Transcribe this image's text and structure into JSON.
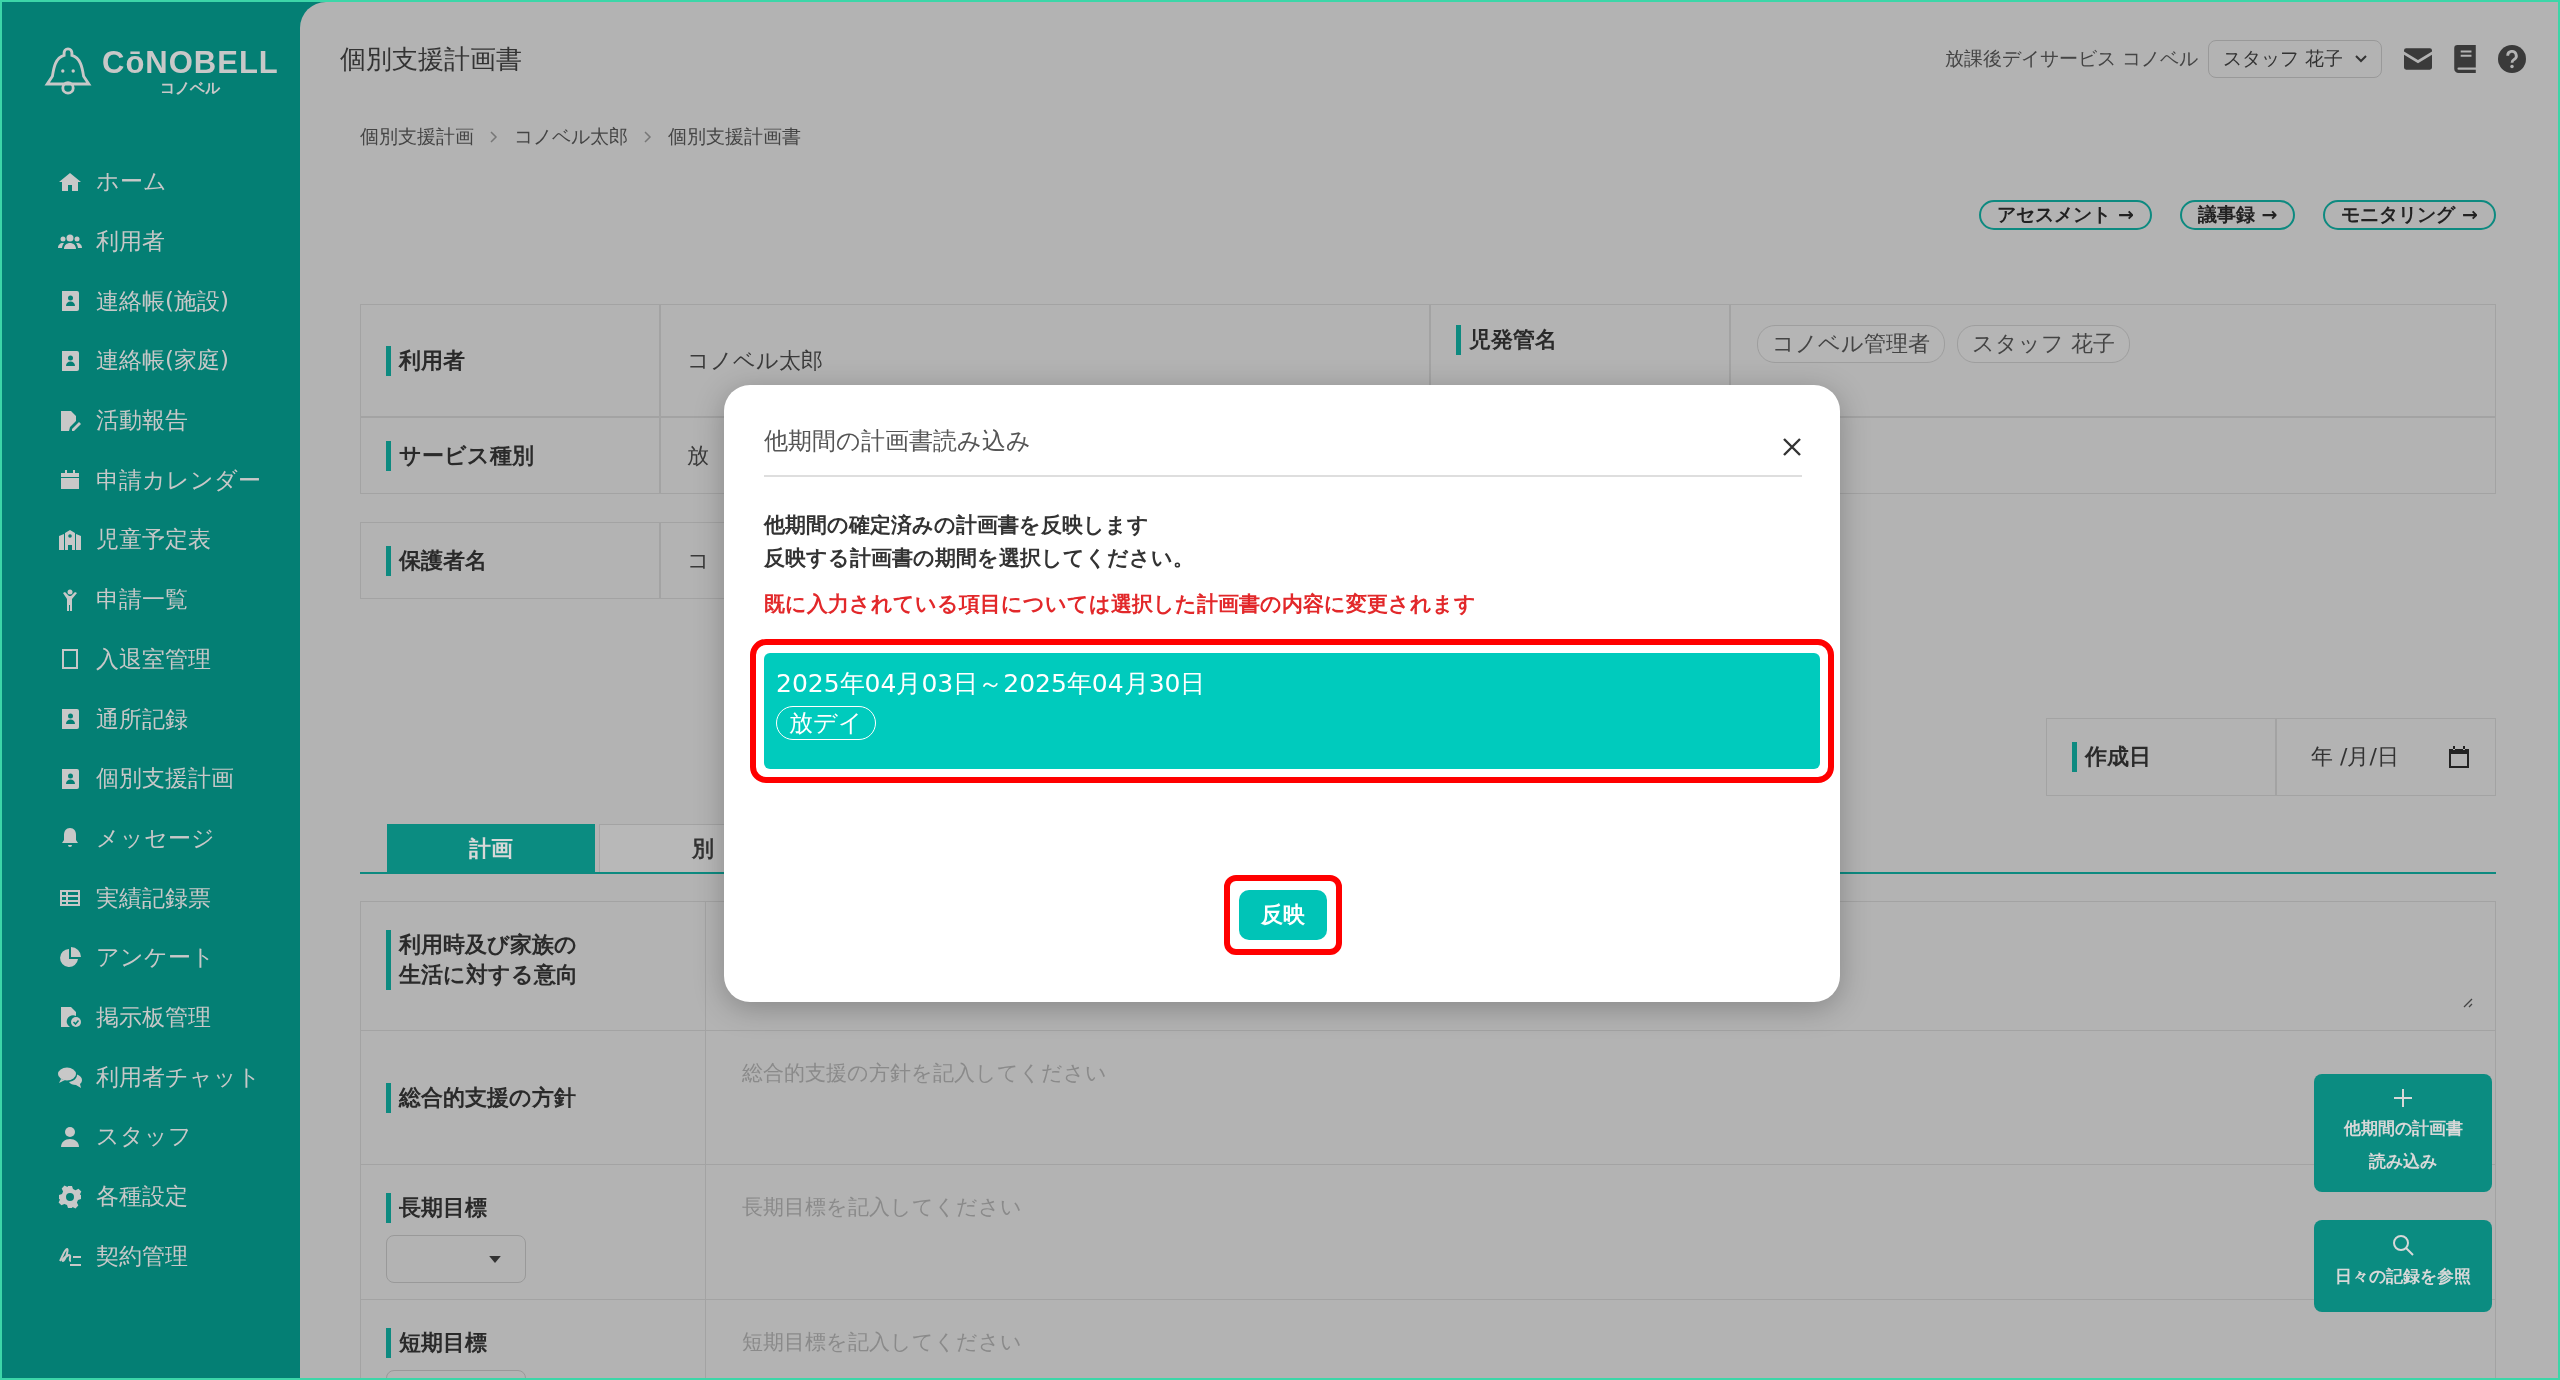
{
  "sidebar": {
    "brand": "CōNOBELL",
    "brand_sub": "コノベル",
    "items": [
      {
        "label": "ホーム",
        "kind": "home"
      },
      {
        "label": "利用者",
        "kind": "users"
      },
      {
        "label": "連絡帳(施設)",
        "kind": "contact"
      },
      {
        "label": "連絡帳(家庭)",
        "kind": "contact"
      },
      {
        "label": "活動報告",
        "kind": "file-pen"
      },
      {
        "label": "申請カレンダー",
        "kind": "calendar"
      },
      {
        "label": "児童予定表",
        "kind": "building"
      },
      {
        "label": "申請一覧",
        "kind": "child"
      },
      {
        "label": "入退室管理",
        "kind": "tablet"
      },
      {
        "label": "通所記録",
        "kind": "contact"
      },
      {
        "label": "個別支援計画",
        "kind": "contact"
      },
      {
        "label": "メッセージ",
        "kind": "bell"
      },
      {
        "label": "実績記録票",
        "kind": "table"
      },
      {
        "label": "アンケート",
        "kind": "pie"
      },
      {
        "label": "掲示板管理",
        "kind": "file-check"
      },
      {
        "label": "利用者チャット",
        "kind": "chat"
      },
      {
        "label": "スタッフ",
        "kind": "user"
      },
      {
        "label": "各種設定",
        "kind": "gear"
      },
      {
        "label": "契約管理",
        "kind": "signature"
      }
    ]
  },
  "header": {
    "title": "個別支援計画書",
    "facility": "放課後デイサービス コノベル",
    "user": "スタッフ 花子"
  },
  "breadcrumb": [
    "個別支援計画",
    "コノベル太郎",
    "個別支援計画書"
  ],
  "nav_buttons": [
    "アセスメント →",
    "議事録 →",
    "モニタリング →"
  ],
  "info": {
    "user_label": "利用者",
    "user_value": "コノベル太郎",
    "manager_label": "児発管名",
    "managers": [
      "コノベル管理者",
      "スタッフ 花子"
    ],
    "service_label": "サービス種別",
    "service_value": "放",
    "guardian_label": "保護者名",
    "guardian_value": "コ"
  },
  "date_field": {
    "label": "作成日",
    "value": "年 /月/日"
  },
  "tabs": [
    {
      "label": "計画",
      "selected": true
    },
    {
      "label": "別",
      "selected": false
    }
  ],
  "form_rows": [
    {
      "kind": "textarea",
      "label": [
        "利用時及び家族の",
        "生活に対する意向"
      ]
    },
    {
      "kind": "text",
      "label": [
        "総合的支援の方針"
      ],
      "placeholder": "総合的支援の方針を記入してください"
    },
    {
      "kind": "select",
      "label": [
        "長期目標"
      ],
      "placeholder": "長期目標を記入してください"
    },
    {
      "kind": "select",
      "label": [
        "短期目標"
      ],
      "placeholder": "短期目標を記入してください"
    }
  ],
  "float_buttons": [
    {
      "kind": "plus",
      "label": [
        "他期間の計画書",
        "読み込み"
      ]
    },
    {
      "kind": "search",
      "label": [
        "日々の記録を参照"
      ]
    }
  ],
  "modal": {
    "title": "他期間の計画書読み込み",
    "lines": [
      "他期間の確定済みの計画書を反映します",
      "反映する計画書の期間を選択してください。"
    ],
    "warning": "既に入力されている項目については選択した計画書の内容に変更されます",
    "periods": [
      {
        "range": "2025年04月03日～2025年04月30日",
        "tag": "放デイ",
        "selected": true
      }
    ],
    "button": "反映"
  }
}
